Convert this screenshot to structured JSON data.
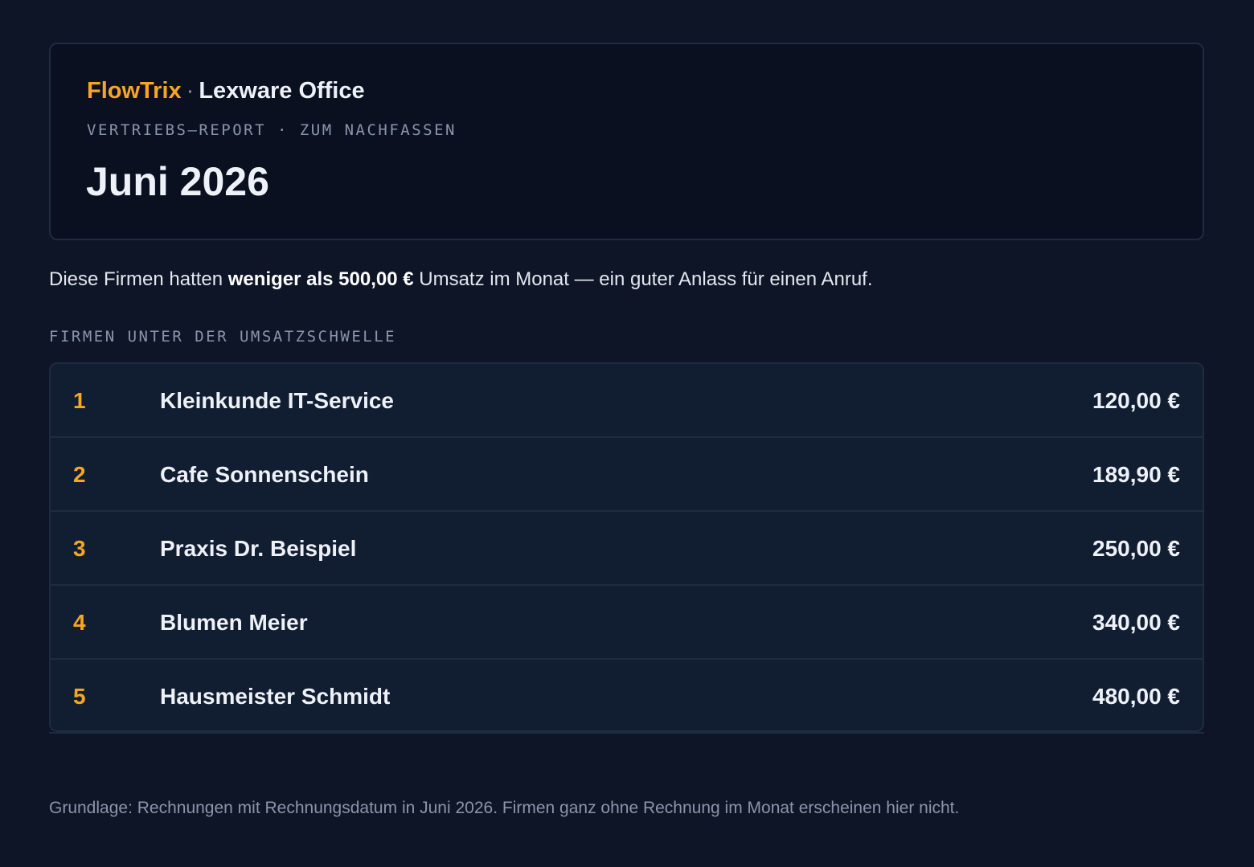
{
  "header": {
    "app_name": "FlowTrix",
    "separator": "·",
    "product_name": "Lexware Office",
    "eyebrow": "VERTRIEBS–REPORT · ZUM NACHFASSEN",
    "title": "Juni 2026"
  },
  "intro": {
    "prefix": "Diese Firmen hatten ",
    "highlight": "weniger als 500,00 €",
    "suffix": " Umsatz im Monat — ein guter Anlass für einen Anruf."
  },
  "section_label": "FIRMEN UNTER DER UMSATZSCHWELLE",
  "rows": [
    {
      "rank": "1",
      "name": "Kleinkunde IT-Service",
      "amount": "120,00 €"
    },
    {
      "rank": "2",
      "name": "Cafe Sonnenschein",
      "amount": "189,90 €"
    },
    {
      "rank": "3",
      "name": "Praxis Dr. Beispiel",
      "amount": "250,00 €"
    },
    {
      "rank": "4",
      "name": "Blumen Meier",
      "amount": "340,00 €"
    },
    {
      "rank": "5",
      "name": "Hausmeister Schmidt",
      "amount": "480,00 €"
    }
  ],
  "footnote": "Grundlage: Rechnungen mit Rechnungsdatum in Juni 2026. Firmen ganz ohne Rechnung im Monat erscheinen hier nicht.",
  "colors": {
    "accent": "#f5a623",
    "background": "#0e1526",
    "card": "#0a1020",
    "row": "#111d31",
    "muted": "#8a95ab"
  }
}
